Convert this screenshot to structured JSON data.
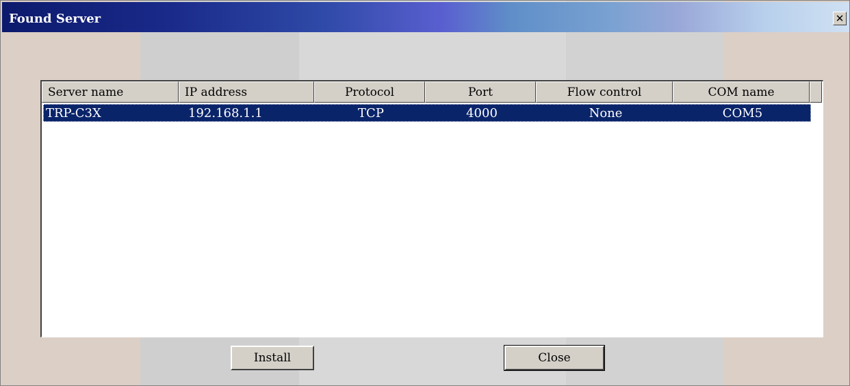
{
  "window": {
    "title": "Found Server",
    "close_glyph": "✕"
  },
  "table": {
    "columns": [
      "Server name",
      "IP address",
      "Protocol",
      "Port",
      "Flow control",
      "COM name"
    ],
    "rows": [
      {
        "server_name": "TRP-C3X",
        "ip_address": "192.168.1.1",
        "protocol": "TCP",
        "port": "4000",
        "flow_control": "None",
        "com_name": "COM5",
        "selected": true
      }
    ]
  },
  "buttons": {
    "install_label": "Install",
    "close_label": "Close"
  },
  "colors": {
    "title_text": "#ffffff",
    "selection": "#0a246a",
    "face": "#d4d0c8"
  }
}
